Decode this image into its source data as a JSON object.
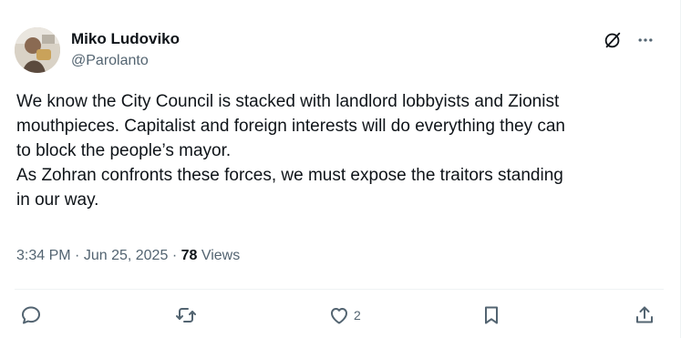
{
  "author": {
    "display_name": "Miko Ludoviko",
    "handle": "@Parolanto",
    "avatar_icon": "avatar-photo"
  },
  "header_icons": {
    "grok": "grok-icon",
    "more": "more-options-icon"
  },
  "tweet": {
    "text": "We know the City Council is stacked with landlord lobbyists and Zionist\nmouthpieces. Capitalist and foreign interests will do everything they can\nto block the people’s mayor.\nAs Zohran confronts these forces, we must expose the traitors standing\nin our way."
  },
  "meta": {
    "time": "3:34 PM",
    "separator": "·",
    "date": "Jun 25, 2025",
    "views_count": "78",
    "views_label": "Views"
  },
  "actions": {
    "reply_icon": "reply-icon",
    "repost_icon": "repost-icon",
    "like_icon": "heart-icon",
    "like_count": "2",
    "bookmark_icon": "bookmark-icon",
    "share_icon": "share-icon"
  },
  "colors": {
    "text_primary": "#0f1419",
    "text_secondary": "#536471",
    "divider": "#eff3f4"
  }
}
